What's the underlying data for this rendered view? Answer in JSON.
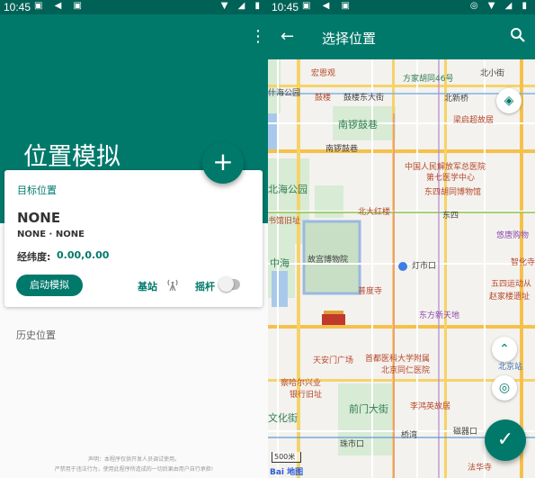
{
  "left": {
    "status": {
      "time": "10:45"
    },
    "title": "位置模拟",
    "card": {
      "section_label": "目标位置",
      "name": "NONE",
      "subtitle": "NONE · NONE",
      "coord_label": "经纬度:",
      "coord_value": "0.00,0.00",
      "start_button": "启动模拟",
      "station_label": "基站",
      "joystick_label": "摇杆",
      "joystick_enabled": false
    },
    "history_label": "历史位置",
    "disclaimer": [
      "声明：本程序仅供开发人员调试使用。",
      "严禁用于违法行为，使用此程序所造成的一切后果由用户自行承担!"
    ]
  },
  "right": {
    "status": {
      "time": "10:45"
    },
    "toolbar": {
      "title": "选择位置"
    },
    "map": {
      "pois": [
        {
          "label": "宏恩观",
          "style": "red"
        },
        {
          "label": "什海公园",
          "style": "gray"
        },
        {
          "label": "鼓楼",
          "style": "red"
        },
        {
          "label": "鼓楼东大街",
          "style": "gray"
        },
        {
          "label": "方家胡同46号",
          "style": "green"
        },
        {
          "label": "北新桥",
          "style": "gray"
        },
        {
          "label": "北小街",
          "style": "gray"
        },
        {
          "label": "南锣鼓巷",
          "style": "green"
        },
        {
          "label": "梁启超故居",
          "style": "red"
        },
        {
          "label": "南锣鼓巷",
          "style": "gray"
        },
        {
          "label": "中国人民解放军总医院",
          "style": "red"
        },
        {
          "label": "第七医学中心",
          "style": "red"
        },
        {
          "label": "北海公园",
          "style": "green"
        },
        {
          "label": "东四胡同博物馆",
          "style": "red"
        },
        {
          "label": "北大红楼",
          "style": "red"
        },
        {
          "label": "东四",
          "style": "gray"
        },
        {
          "label": "书馆旧址",
          "style": "red"
        },
        {
          "label": "中海",
          "style": "green"
        },
        {
          "label": "故宫博物院",
          "style": "gray"
        },
        {
          "label": "灯市口",
          "style": "gray"
        },
        {
          "label": "悠唐购物",
          "style": "purple"
        },
        {
          "label": "智化寺",
          "style": "red"
        },
        {
          "label": "普度寺",
          "style": "red"
        },
        {
          "label": "五四运动从",
          "style": "red"
        },
        {
          "label": "赵家楼遗址",
          "style": "red"
        },
        {
          "label": "东方新天地",
          "style": "purple"
        },
        {
          "label": "天安门广场",
          "style": "red"
        },
        {
          "label": "首都医科大学附属",
          "style": "red"
        },
        {
          "label": "北京同仁医院",
          "style": "red"
        },
        {
          "label": "北京站",
          "style": "blue"
        },
        {
          "label": "察哈尔兴业",
          "style": "red"
        },
        {
          "label": "银行旧址",
          "style": "red"
        },
        {
          "label": "文化街",
          "style": "green"
        },
        {
          "label": "前门大街",
          "style": "green"
        },
        {
          "label": "李鸿英故居",
          "style": "red"
        },
        {
          "label": "珠市口",
          "style": "gray"
        },
        {
          "label": "桥湾",
          "style": "gray"
        },
        {
          "label": "磁器口",
          "style": "gray"
        },
        {
          "label": "法华寺",
          "style": "red"
        }
      ],
      "scale_label": "500米",
      "brand": "Bai 地图"
    }
  },
  "colors": {
    "primary": "#00796b",
    "primary_dark": "#006156",
    "accent_text": "#00796b"
  },
  "icons": {
    "menu": "more-vert-icon",
    "add": "add-icon",
    "station": "cell-tower-icon",
    "back": "arrow-back-icon",
    "search": "search-icon",
    "layers": "layers-icon",
    "heading": "navigation-icon",
    "locate": "my-location-icon",
    "confirm": "check-icon"
  }
}
